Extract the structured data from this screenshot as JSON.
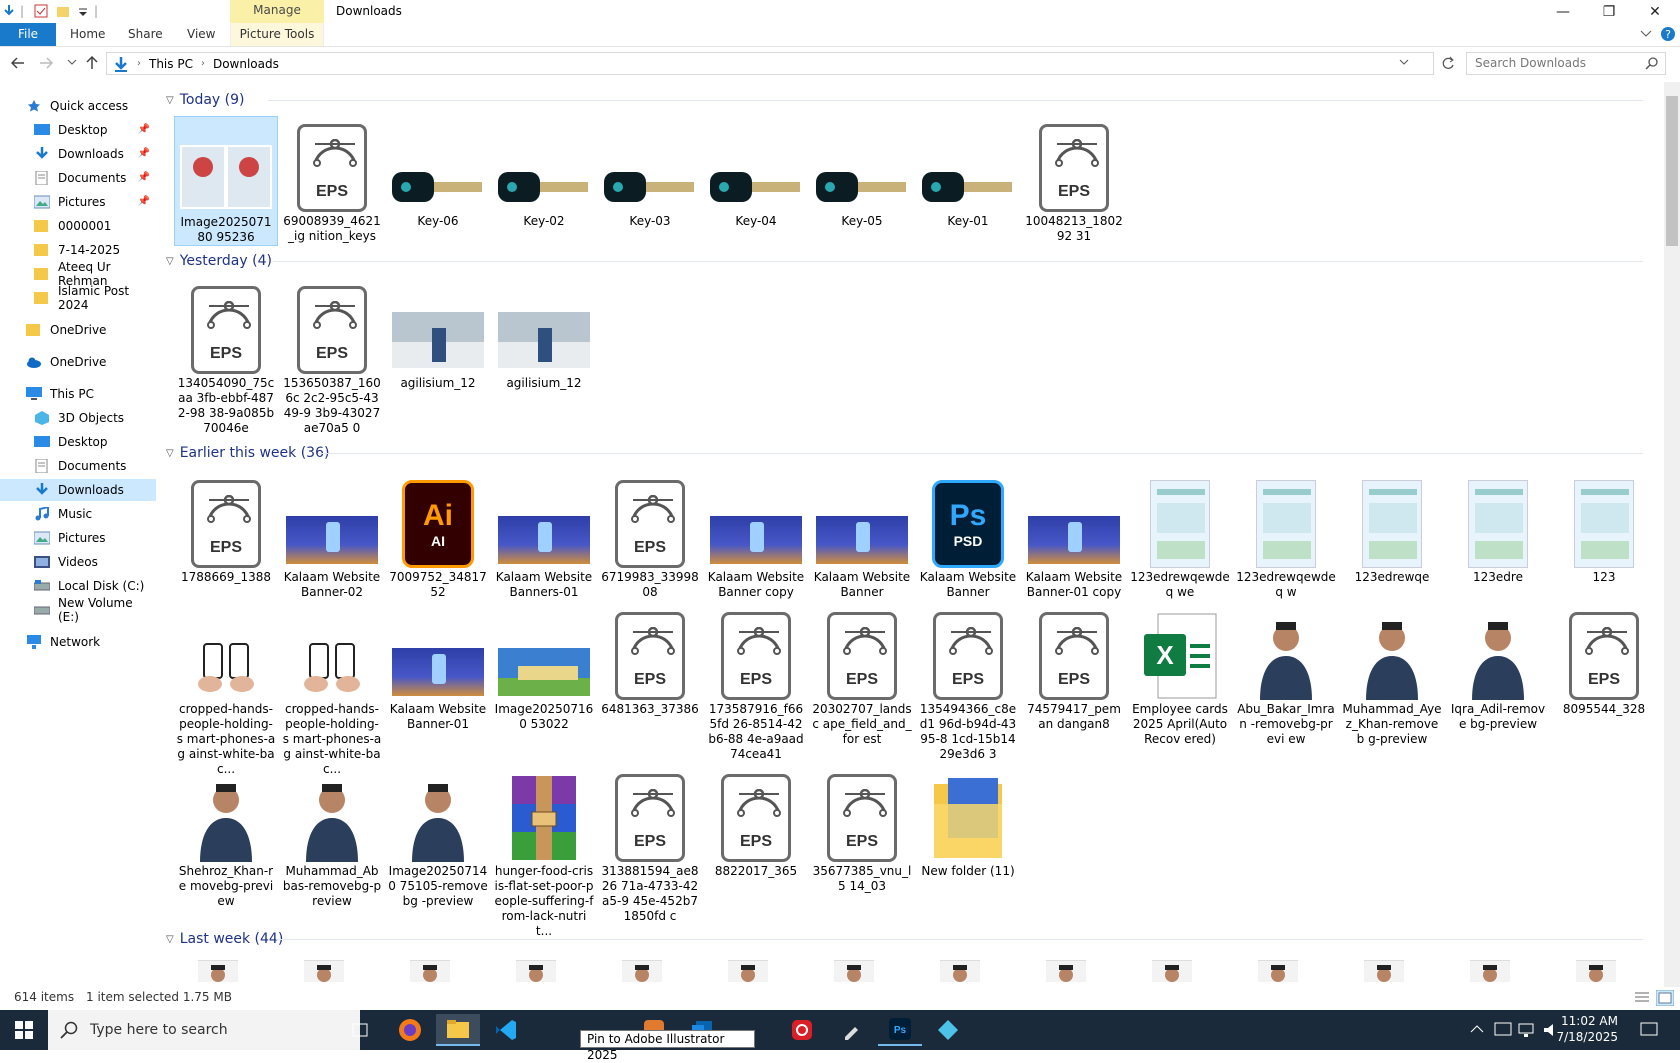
{
  "window": {
    "title": "Downloads",
    "manage_tab": "Manage",
    "picture_tools": "Picture Tools",
    "minimize": "—",
    "maximize": "❐",
    "close": "✕"
  },
  "ribbon": {
    "file": "File",
    "home": "Home",
    "share": "Share",
    "view": "View"
  },
  "address": {
    "path": [
      "This PC",
      "Downloads"
    ],
    "search_placeholder": "Search Downloads"
  },
  "sidebar": {
    "items": [
      {
        "label": "Quick access",
        "icon": "star-icon"
      },
      {
        "label": "Desktop",
        "icon": "desktop-icon",
        "pinned": true
      },
      {
        "label": "Downloads",
        "icon": "download-icon",
        "pinned": true
      },
      {
        "label": "Documents",
        "icon": "documents-icon",
        "pinned": true
      },
      {
        "label": "Pictures",
        "icon": "pictures-icon",
        "pinned": true
      },
      {
        "label": "0000001",
        "icon": "folder-icon"
      },
      {
        "label": "7-14-2025",
        "icon": "folder-icon"
      },
      {
        "label": "Ateeq Ur Rehman",
        "icon": "folder-icon"
      },
      {
        "label": "Islamic Post 2024",
        "icon": "folder-icon"
      },
      {
        "label": "OneDrive",
        "icon": "folder-icon"
      },
      {
        "label": "OneDrive",
        "icon": "cloud-icon"
      },
      {
        "label": "This PC",
        "icon": "pc-icon"
      },
      {
        "label": "3D Objects",
        "icon": "cube-icon"
      },
      {
        "label": "Desktop",
        "icon": "desktop-icon"
      },
      {
        "label": "Documents",
        "icon": "documents-icon"
      },
      {
        "label": "Downloads",
        "icon": "download-icon",
        "selected": true
      },
      {
        "label": "Music",
        "icon": "music-icon"
      },
      {
        "label": "Pictures",
        "icon": "pictures-icon"
      },
      {
        "label": "Videos",
        "icon": "videos-icon"
      },
      {
        "label": "Local Disk (C:)",
        "icon": "disk-icon"
      },
      {
        "label": "New Volume (E:)",
        "icon": "disk-icon"
      },
      {
        "label": "Network",
        "icon": "network-icon"
      }
    ]
  },
  "groups": {
    "today": {
      "title": "Today (9)",
      "items": [
        {
          "name": "Image202507180 95236",
          "kind": "photo-pair"
        },
        {
          "name": "69008939_4621_ig nition_keys",
          "kind": "eps"
        },
        {
          "name": "Key-06",
          "kind": "key"
        },
        {
          "name": "Key-02",
          "kind": "key"
        },
        {
          "name": "Key-03",
          "kind": "key"
        },
        {
          "name": "Key-04",
          "kind": "key"
        },
        {
          "name": "Key-05",
          "kind": "key"
        },
        {
          "name": "Key-01",
          "kind": "key"
        },
        {
          "name": "10048213_180292 31",
          "kind": "eps"
        }
      ]
    },
    "yesterday": {
      "title": "Yesterday (4)",
      "items": [
        {
          "name": "134054090_75caa 3fb-ebbf-4872-98 38-9a085b70046e",
          "kind": "eps"
        },
        {
          "name": "153650387_1606c 2c2-95c5-4349-9 3b9-43027ae70a5 0",
          "kind": "eps"
        },
        {
          "name": "agilisium_12",
          "kind": "photo-car"
        },
        {
          "name": "agilisium_12",
          "kind": "photo-car"
        }
      ]
    },
    "earlier": {
      "title": "Earlier this week (36)",
      "rows": [
        [
          {
            "name": "1788669_1388",
            "kind": "eps"
          },
          {
            "name": "Kalaam Website Banner-02",
            "kind": "banner"
          },
          {
            "name": "7009752_3481752",
            "kind": "ai"
          },
          {
            "name": "Kalaam Website Banners-01",
            "kind": "banner"
          },
          {
            "name": "6719983_3399808",
            "kind": "eps"
          },
          {
            "name": "Kalaam Website Banner copy",
            "kind": "banner"
          },
          {
            "name": "Kalaam Website Banner",
            "kind": "banner"
          },
          {
            "name": "Kalaam Website Banner",
            "kind": "psd"
          },
          {
            "name": "Kalaam Website Banner-01 copy",
            "kind": "banner"
          },
          {
            "name": "123edrewqewdeq we",
            "kind": "doc"
          },
          {
            "name": "123edrewqewdeq w",
            "kind": "doc"
          },
          {
            "name": "123edrewqe",
            "kind": "doc"
          },
          {
            "name": "123edre",
            "kind": "doc"
          },
          {
            "name": "123",
            "kind": "doc"
          }
        ],
        [
          {
            "name": "cropped-hands-people-holding-s mart-phones-ag ainst-white-bac...",
            "kind": "photo-hands"
          },
          {
            "name": "cropped-hands-people-holding-s mart-phones-ag ainst-white-bac...",
            "kind": "photo-hands"
          },
          {
            "name": "Kalaam Website Banner-01",
            "kind": "banner"
          },
          {
            "name": "Image202507160 53022",
            "kind": "photo-mosque"
          },
          {
            "name": "6481363_37386",
            "kind": "eps"
          },
          {
            "name": "173587916_f665fd 26-8514-42b6-88 4e-a9aad74cea41",
            "kind": "eps"
          },
          {
            "name": "20302707_landsc ape_field_and_for est",
            "kind": "eps"
          },
          {
            "name": "135494366_c8ed1 96d-b94d-4395-8 1cd-15b1429e3d6 3",
            "kind": "eps"
          },
          {
            "name": "74579417_peman dangan8",
            "kind": "eps"
          },
          {
            "name": "Employee cards 2025 April(AutoRecov ered)",
            "kind": "excel"
          },
          {
            "name": "Abu_Bakar_Imran -removebg-previ ew",
            "kind": "photo-person"
          },
          {
            "name": "Muhammad_Aye z_Khan-removeb g-preview",
            "kind": "photo-person"
          },
          {
            "name": "Iqra_Adil-remove bg-preview",
            "kind": "photo-person"
          },
          {
            "name": "8095544_328",
            "kind": "eps"
          }
        ],
        [
          {
            "name": "Shehroz_Khan-re movebg-preview",
            "kind": "photo-person"
          },
          {
            "name": "Muhammad_Ab bas-removebg-p review",
            "kind": "photo-person"
          },
          {
            "name": "Image202507140 75105-removebg -preview",
            "kind": "photo-person"
          },
          {
            "name": "hunger-food-cris is-flat-set-poor-p eople-suffering-f rom-lack-nutrit...",
            "kind": "winrar"
          },
          {
            "name": "313881594_ae826 71a-4733-42a5-9 45e-452b71850fd c",
            "kind": "eps"
          },
          {
            "name": "8822017_365",
            "kind": "eps"
          },
          {
            "name": "35677385_vnu_l5 14_03",
            "kind": "eps"
          },
          {
            "name": "New folder (11)",
            "kind": "folder"
          }
        ]
      ]
    },
    "lastweek": {
      "title": "Last week (44)"
    }
  },
  "status": {
    "count": "614 items",
    "selected": "1 item selected  1.75 MB"
  },
  "taskbar": {
    "search": "Type here to search",
    "time": "11:02 AM",
    "date": "7/18/2025",
    "tooltip": "Pin to Adobe Illustrator 2025"
  },
  "colors": {
    "accent": "#1979ca",
    "selected": "#cce8ff",
    "group_header": "#1e3287",
    "taskbar": "#1a2a3a"
  }
}
